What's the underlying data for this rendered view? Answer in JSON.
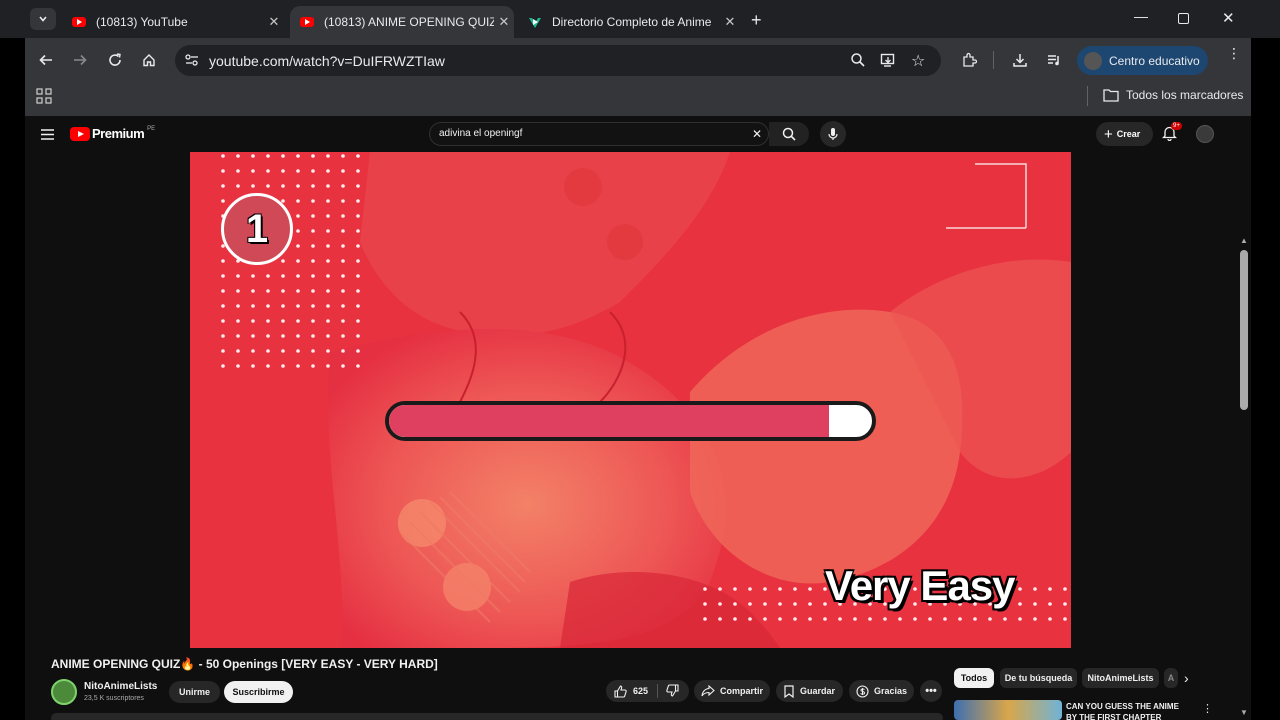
{
  "browser": {
    "tabs": [
      {
        "title": "(10813) YouTube"
      },
      {
        "title": "(10813) ANIME OPENING QUIZ"
      },
      {
        "title": "Directorio Completo de Anime"
      }
    ],
    "url": "youtube.com/watch?v=DuIFRWZTIaw",
    "profile": "Centro educativo",
    "bookmarks_label": "Todos los marcadores"
  },
  "youtube": {
    "logo": "Premium",
    "region": "PE",
    "search_query": "adivina el openingf",
    "create_label": "Crear",
    "notification_badge": "9+",
    "video": {
      "counter": "1",
      "progress": 0.91,
      "caption": "Very Easy"
    },
    "title": "ANIME OPENING QUIZ🔥 - 50 Openings [VERY EASY - VERY HARD]",
    "channel": "NitoAnimeLists",
    "subscribers": "23,5 K suscriptores",
    "join_label": "Unirme",
    "subscribe_label": "Suscribirme",
    "likes": "625",
    "share_label": "Compartir",
    "save_label": "Guardar",
    "thanks_label": "Gracias",
    "chips": [
      "Todos",
      "De tu búsqueda",
      "NitoAnimeLists",
      "A"
    ],
    "rec_title_1": "CAN YOU GUESS THE ANIME",
    "rec_title_2": "BY THE FIRST CHAPTER"
  },
  "colors": {
    "yt_red": "#ff0000",
    "video_red": "#e8323f",
    "progress_fill": "#e0405f",
    "profile_blue": "#1d4671"
  }
}
